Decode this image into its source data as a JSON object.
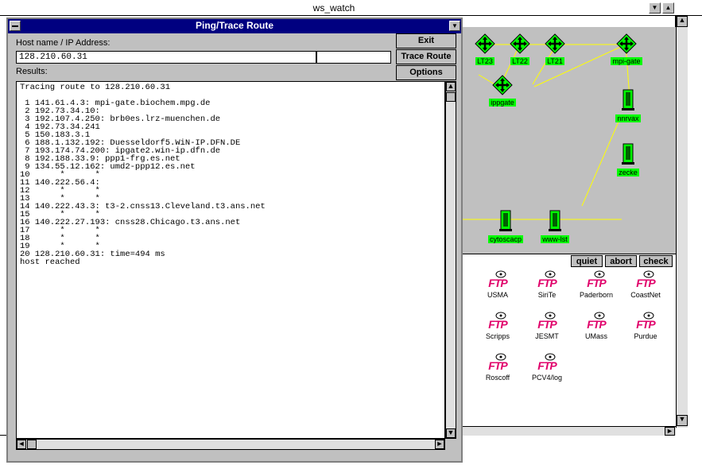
{
  "main_window": {
    "title": "ws_watch"
  },
  "ping_dialog": {
    "title": "Ping/Trace Route",
    "host_label": "Host name / IP Address:",
    "host_value": "128.210.60.31",
    "results_label": "Results:",
    "buttons": {
      "exit": "Exit",
      "trace_route": "Trace Route",
      "options": "Options"
    },
    "results_lines": [
      "Tracing route to 128.210.60.31",
      "",
      " 1 141.61.4.3: mpi-gate.biochem.mpg.de",
      " 2 192.73.34.10:",
      " 3 192.107.4.250: brb0es.lrz-muenchen.de",
      " 4 192.73.34.241",
      " 5 150.183.3.1",
      " 6 188.1.132.192: Duesseldorf5.WiN-IP.DFN.DE",
      " 7 193.174.74.200: ipgate2.win-ip.dfn.de",
      " 8 192.188.33.9: ppp1-frg.es.net",
      " 9 134.55.12.162: umd2-ppp12.es.net",
      "10      *      *",
      "11 140.222.56.4:",
      "12      *      *",
      "13      *      *",
      "14 140.222.43.3: t3-2.cnss13.Cleveland.t3.ans.net",
      "15      *      *",
      "16 140.222.27.193: cnss28.Chicago.t3.ans.net",
      "17      *      *",
      "18      *      *",
      "19      *      *",
      "20 128.210.60.31: time=494 ms",
      "host reached"
    ]
  },
  "network_map": {
    "nodes": [
      {
        "label": "LT23",
        "kind": "router"
      },
      {
        "label": "LT22",
        "kind": "router"
      },
      {
        "label": "LT21",
        "kind": "router"
      },
      {
        "label": "mpi-gate",
        "kind": "router"
      },
      {
        "label": "ippgate",
        "kind": "router"
      },
      {
        "label": "nnrvax",
        "kind": "host"
      },
      {
        "label": "zecke",
        "kind": "host"
      },
      {
        "label": "cytoscacp",
        "kind": "host"
      },
      {
        "label": "www-lst",
        "kind": "host"
      }
    ],
    "controls": {
      "quiet": "quiet",
      "abort": "abort",
      "check": "check"
    }
  },
  "ftp_panel": {
    "logo_text": "FTP",
    "sites": [
      "USMA",
      "SiriTe",
      "Paderborn",
      "CoastNet",
      "Scripps",
      "JESMT",
      "UMass",
      "Purdue",
      "Roscoff",
      "PCV4/log"
    ]
  },
  "colors": {
    "title_bar": "#000080",
    "node_green": "#00ff00",
    "link_yellow": "#ffff00",
    "ftp_red": "#e0006a",
    "chrome": "#c0c0c0"
  }
}
